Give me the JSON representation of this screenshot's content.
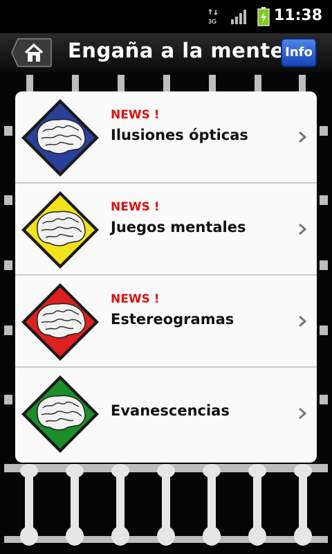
{
  "status_bar": {
    "network": "3G",
    "time": "11:38",
    "icons": [
      "network-3g-icon",
      "signal-icon",
      "battery-charging-icon"
    ]
  },
  "header": {
    "title": "Engaña a la mente",
    "home_icon": "home-icon",
    "info_label": "Info"
  },
  "list": {
    "items": [
      {
        "badge": "NEWS !",
        "label": "Ilusiones ópticas",
        "color": "#2a3f9a"
      },
      {
        "badge": "NEWS !",
        "label": "Juegos mentales",
        "color": "#f2e21c"
      },
      {
        "badge": "NEWS !",
        "label": "Estereogramas",
        "color": "#dd2020"
      },
      {
        "badge": "",
        "label": "Evanescencias",
        "color": "#1a8f2a"
      }
    ]
  },
  "colors": {
    "news": "#e01010",
    "info_button": "#2f63d3"
  }
}
